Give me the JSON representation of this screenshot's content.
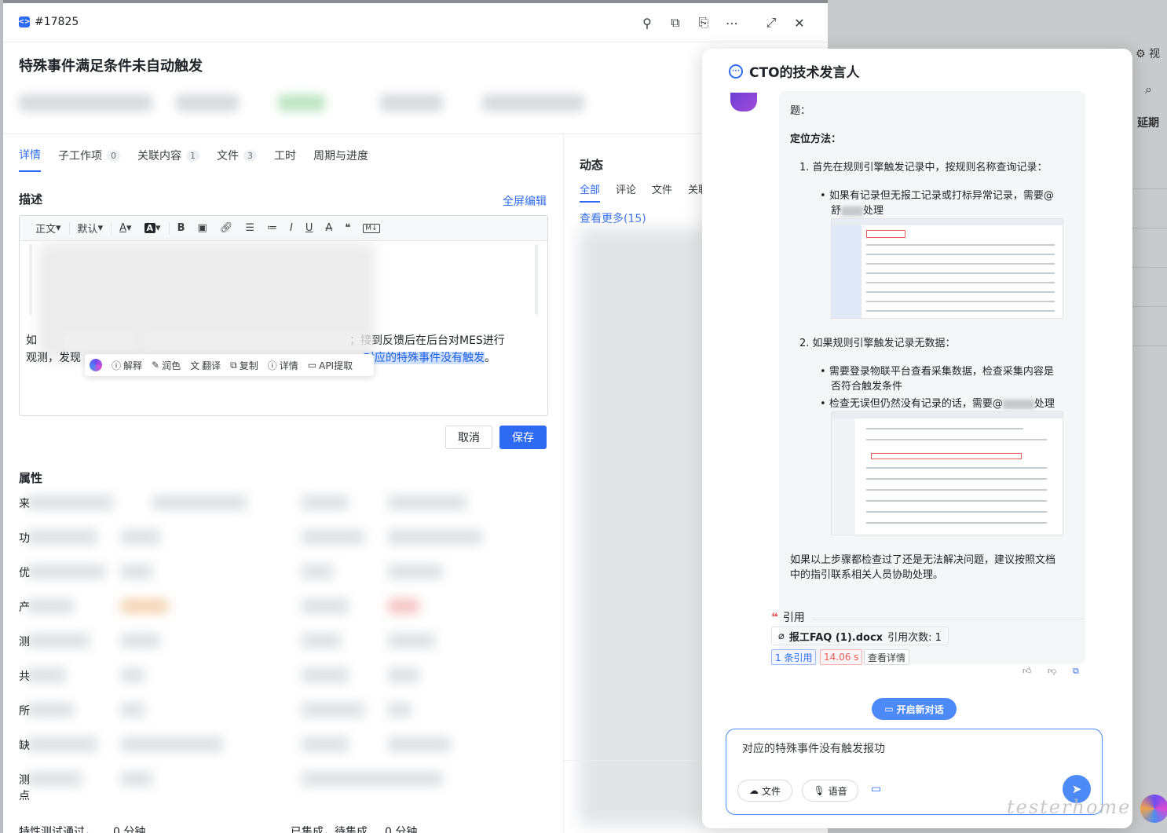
{
  "issue": {
    "id": "#17825",
    "title": "特殊事件满足条件未自动触发"
  },
  "header_icons": [
    "pin-icon",
    "copy-icon",
    "link-icon",
    "more-icon",
    "expand-icon",
    "close-icon"
  ],
  "tabs": [
    {
      "label": "详情",
      "count": ""
    },
    {
      "label": "子工作项",
      "count": "0"
    },
    {
      "label": "关联内容",
      "count": "1"
    },
    {
      "label": "文件",
      "count": "3"
    },
    {
      "label": "工时",
      "count": ""
    },
    {
      "label": "周期与进度",
      "count": ""
    }
  ],
  "description": {
    "title": "描述",
    "fullscreen_label": "全屏编辑",
    "toolbar": {
      "paragraph": "正文",
      "font": "默认"
    },
    "text_line1_a": "如",
    "text_line1_b": "；接到反馈后在后台对MES进行",
    "text_line2_a": "观测，发现",
    "text_line2_hl": "对应的特殊事件没有触发",
    "text_line2_end": "。"
  },
  "float_toolbar": {
    "explain": "解释",
    "polish": "润色",
    "translate": "翻译",
    "copy": "复制",
    "detail": "详情",
    "api": "API提取"
  },
  "buttons": {
    "cancel": "取消",
    "save": "保存"
  },
  "properties": {
    "title": "属性",
    "labels": [
      "来",
      "功",
      "优",
      "产",
      "测",
      "共",
      "所",
      "缺",
      "测",
      "点"
    ],
    "bottom_left_label": "特性测试通过，",
    "bottom_left_value": "0 分钟",
    "bottom_right_label": "已集成，待集成",
    "bottom_right_value": "0 分钟"
  },
  "activity": {
    "title": "动态",
    "tabs": [
      "全部",
      "评论",
      "文件",
      "关联"
    ],
    "more_label": "查看更多(15)"
  },
  "background": {
    "view_label": "视",
    "delay_label": "延期"
  },
  "chat": {
    "title": "CTO的技术发言人",
    "intro": "题：",
    "locate_title": "定位方法：",
    "step1": "1. 首先在规则引擎触发记录中，按规则名称查询记录：",
    "step1_bullet_a": "如果有记录但无报工记录或打标异常记录，需要@",
    "step1_bullet_b": "舒",
    "step1_bullet_c": "处理",
    "step2": "2. 如果规则引擎触发记录无数据：",
    "step2_bullet1_a": "需要登录物联平台查看采集数据，检查采集内容是",
    "step2_bullet1_b": "否符合触发条件",
    "step2_bullet2_a": "检查无误但仍然没有记录的话，需要@",
    "step2_bullet2_b": "处理",
    "closing_a": "如果以上步骤都检查过了还是无法解决问题，建议按照文档",
    "closing_b": "中的指引联系相关人员协助处理。",
    "cite_title": "引用",
    "cite_file": "报工FAQ (1).docx",
    "cite_count": "引用次数: 1",
    "tag_refs": "1 条引用",
    "tag_time": "14.06 s",
    "tag_detail": "查看详情",
    "new_chat": "开启新对话",
    "input_value": "对应的特殊事件没有触发报功",
    "file_btn": "文件",
    "voice_btn": "语音"
  },
  "watermark": "testerhome.com"
}
